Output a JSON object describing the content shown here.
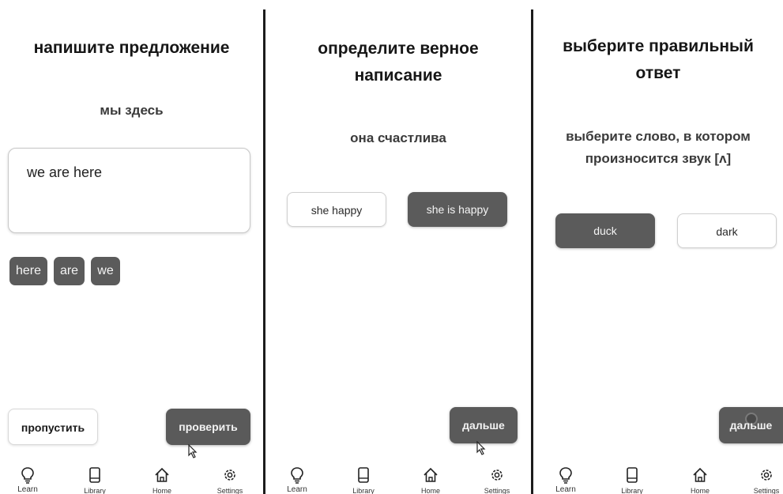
{
  "screen1": {
    "title": "напишите предложение",
    "prompt": "мы здесь",
    "answer_text": "we are here",
    "chips": [
      "here",
      "are",
      "we"
    ],
    "skip_label": "пропустить",
    "check_label": "проверить"
  },
  "screen2": {
    "title_line1": "определите верное",
    "title_line2": "написание",
    "prompt": "она счастлива",
    "options": [
      "she happy",
      "she is happy"
    ],
    "selected_option": "she is happy",
    "next_label": "дальше"
  },
  "screen3": {
    "title_line1": "выберите правильный",
    "title_line2": "ответ",
    "prompt_line1": "выберите слово, в котором",
    "prompt_line2": "произносится звук [ʌ]",
    "options": [
      "duck",
      "dark"
    ],
    "selected_option": "duck",
    "next_label": "дальше"
  },
  "nav": {
    "items": [
      {
        "label": "Learn",
        "icon": "lightbulb-icon"
      },
      {
        "label": "Library",
        "icon": "book-icon"
      },
      {
        "label": "Home",
        "icon": "home-icon"
      },
      {
        "label": "Settings",
        "icon": "gear-icon"
      }
    ]
  },
  "colors": {
    "selected_fill": "#5b5b5b",
    "button_dark": "#5a5a5a",
    "background": "#ffffff",
    "divider": "#1c1c1c"
  }
}
